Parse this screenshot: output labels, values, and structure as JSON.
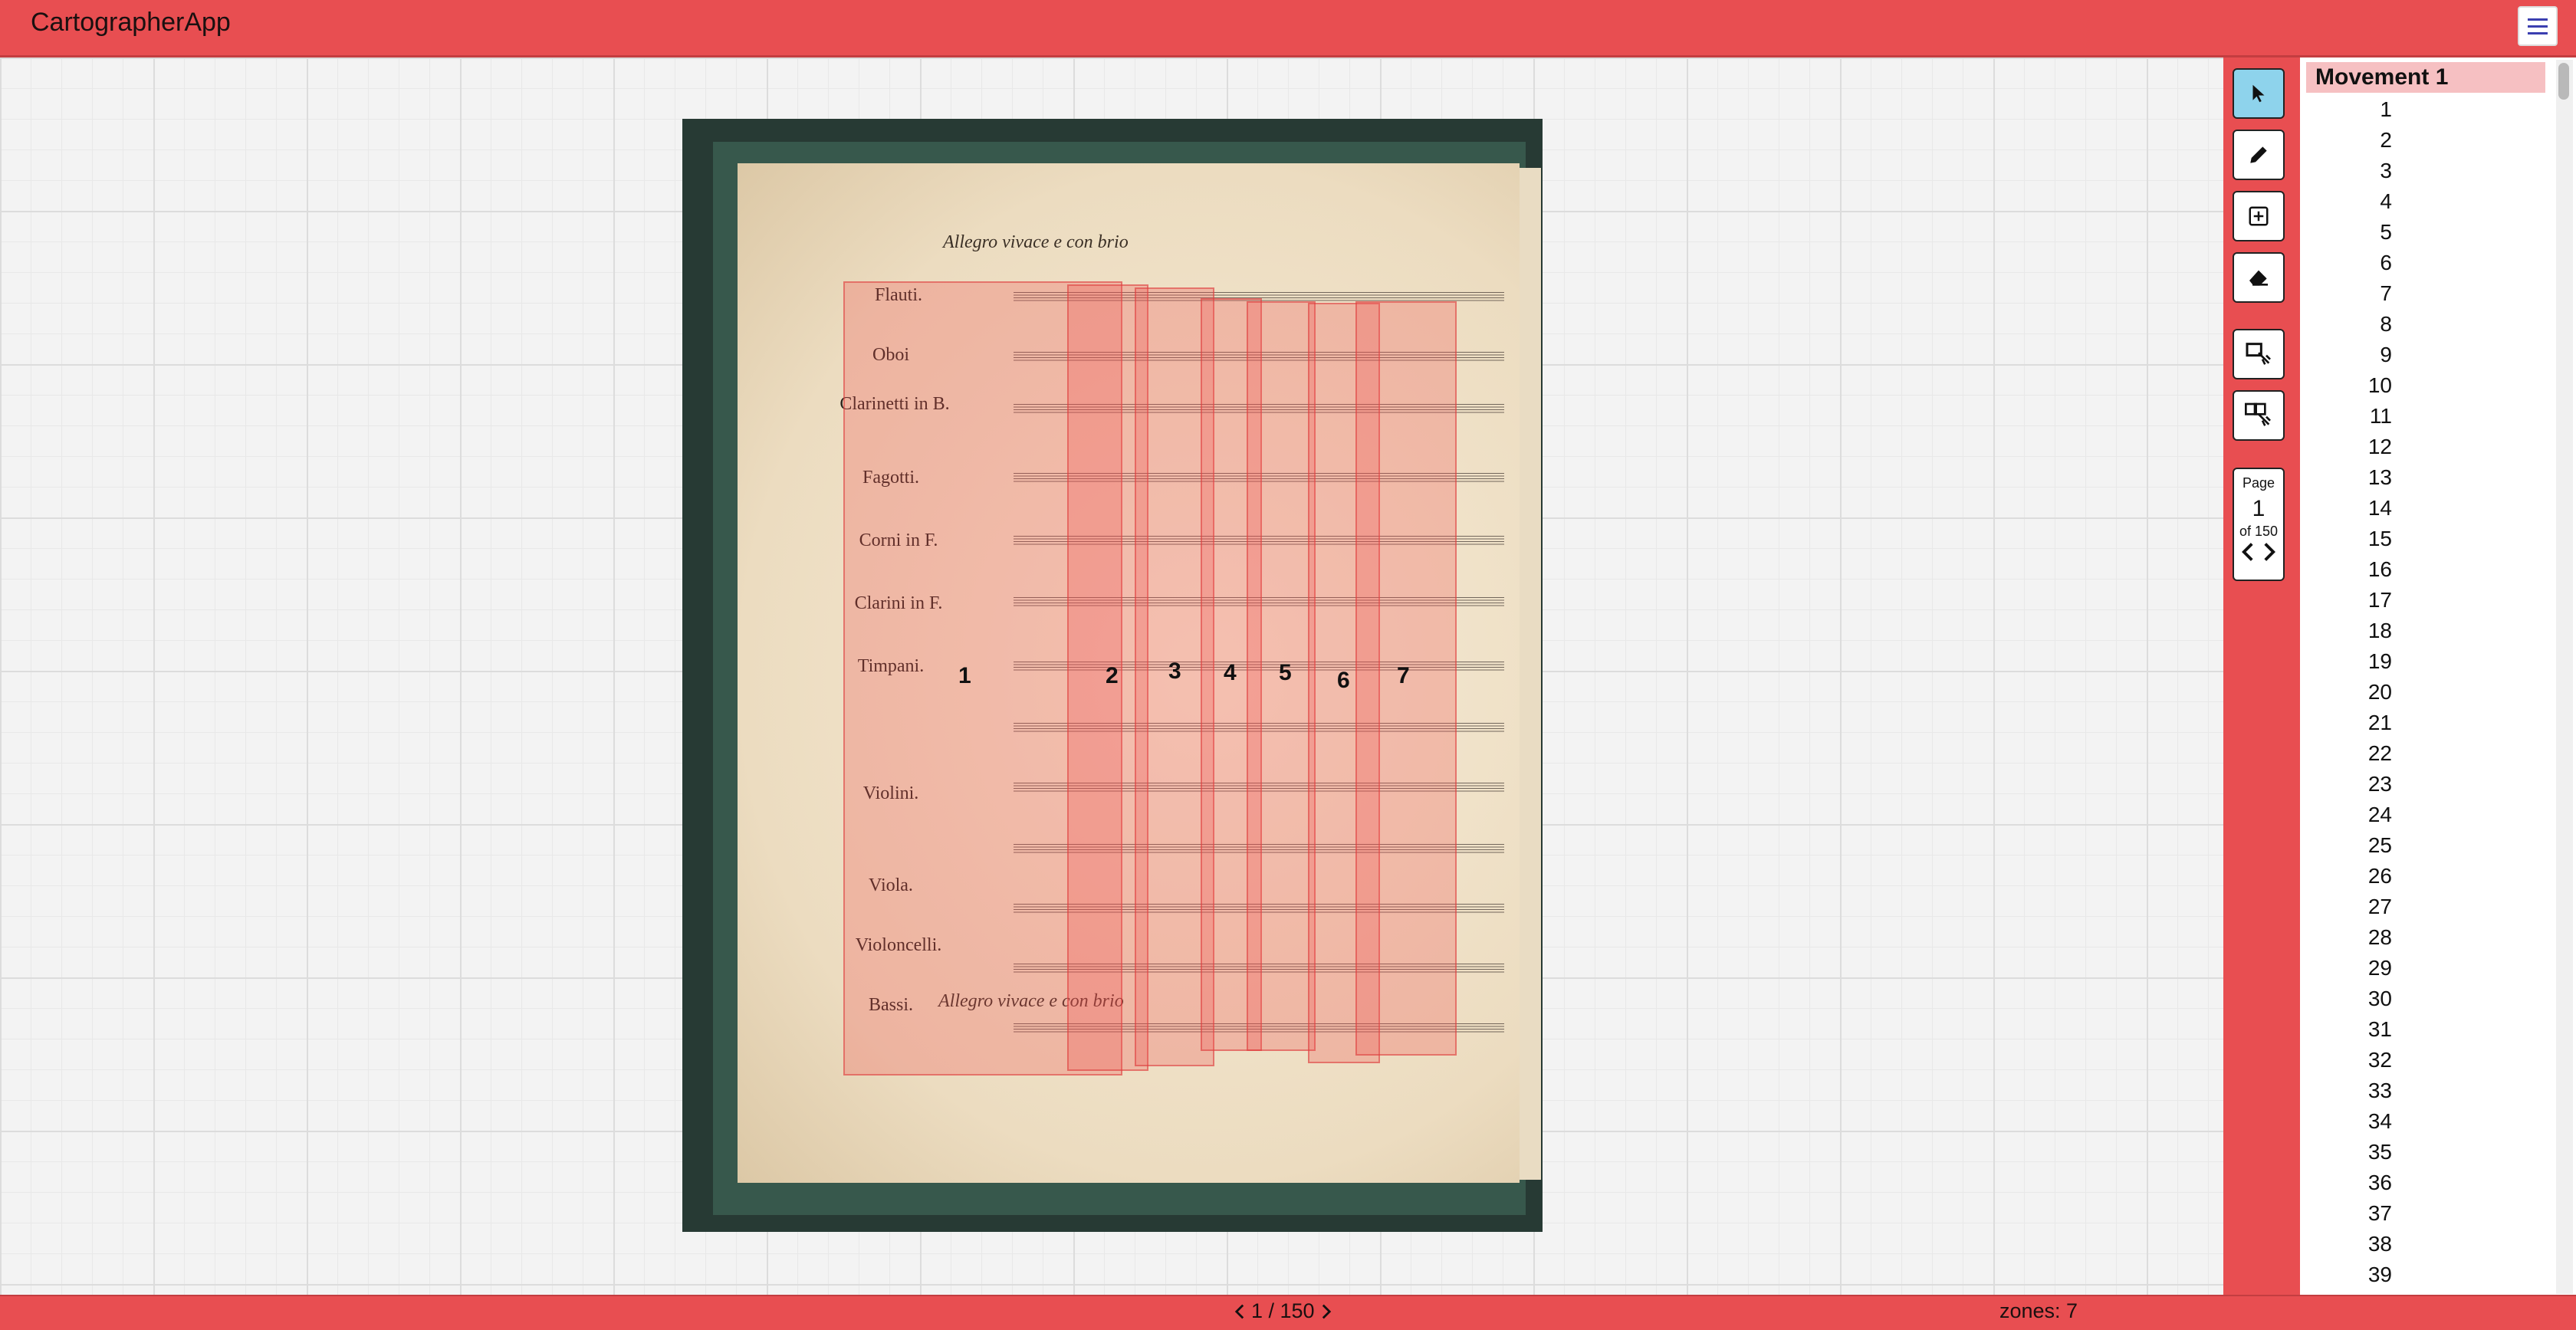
{
  "app": {
    "title": "CartographerApp"
  },
  "score": {
    "tempo_top": "Allegro vivace e con brio",
    "tempo_bottom": "Allegro vivace e con brio",
    "instruments": [
      "Flauti.",
      "Oboi",
      "Clarinetti in B.",
      "Fagotti.",
      "Corni in F.",
      "Clarini in F.",
      "Timpani.",
      "",
      "Violini.",
      "",
      "Viola.",
      "Violoncelli.",
      "Bassi."
    ]
  },
  "zones": [
    {
      "label": "1"
    },
    {
      "label": "2"
    },
    {
      "label": "3"
    },
    {
      "label": "4"
    },
    {
      "label": "5"
    },
    {
      "label": "6"
    },
    {
      "label": "7"
    }
  ],
  "toolbar": {
    "tools": [
      "select",
      "draw",
      "add-zone",
      "erase",
      "combine",
      "split"
    ],
    "active": "select",
    "page_label": "Page",
    "page_number": "1",
    "page_of": "of 150"
  },
  "sidebar": {
    "movement_title": "Movement 1",
    "measures": [
      "1",
      "2",
      "3",
      "4",
      "5",
      "6",
      "7",
      "8",
      "9",
      "10",
      "11",
      "12",
      "13",
      "14",
      "15",
      "16",
      "17",
      "18",
      "19",
      "20",
      "21",
      "22",
      "23",
      "24",
      "25",
      "26",
      "27",
      "28",
      "29",
      "30",
      "31",
      "32",
      "33",
      "34",
      "35",
      "36",
      "37",
      "38",
      "39"
    ]
  },
  "status": {
    "pager_text": "1 / 150",
    "zones_text": "zones: 7"
  },
  "colors": {
    "accent": "#e84e51",
    "zone_fill": "#f05050",
    "active_tool": "#8ed3ec"
  }
}
